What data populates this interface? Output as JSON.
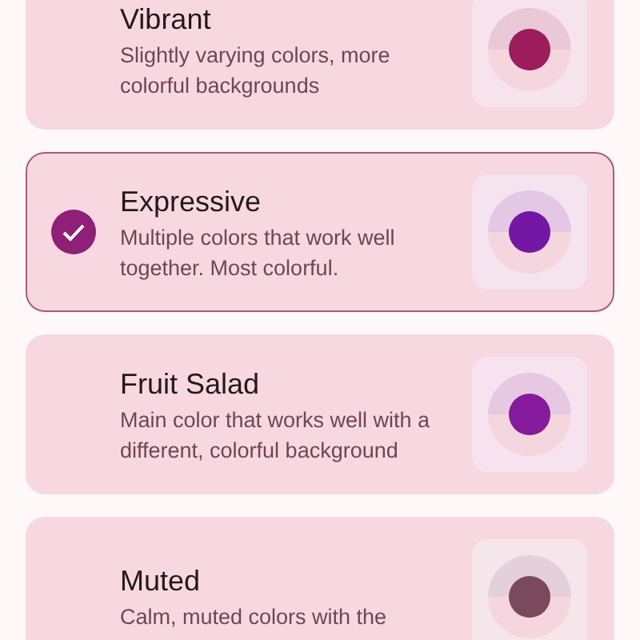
{
  "styles": [
    {
      "title": "Vibrant",
      "description": "Slightly varying colors, more colorful backgrounds",
      "selected": false,
      "color": "#9c1c5c"
    },
    {
      "title": "Expressive",
      "description": "Multiple colors that work well together. Most colorful.",
      "selected": true,
      "color": "#7417a4"
    },
    {
      "title": "Fruit Salad",
      "description": "Main color that works well with a different, colorful background",
      "selected": false,
      "color": "#861a9c"
    },
    {
      "title": "Muted",
      "description": "Calm, muted colors with the",
      "selected": false,
      "color": "#7a4a5c"
    }
  ]
}
